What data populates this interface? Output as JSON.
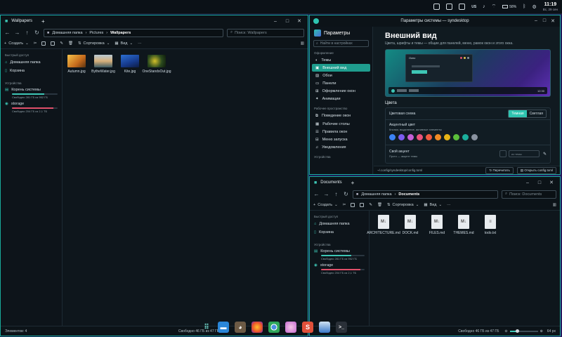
{
  "topbar": {
    "lang": "US",
    "battery": "58%",
    "time": "11:19",
    "date": "Вс, 29 сен"
  },
  "win_wallpapers": {
    "title": "Wallpapers",
    "path": [
      "Домашняя папка",
      "Pictures",
      "Wallpapers"
    ],
    "search_placeholder": "Поиск: Wallpapers",
    "actions": {
      "create": "Создать",
      "sort": "Сортировка",
      "view": "Вид"
    },
    "sidebar": {
      "quick": "Быстрый доступ",
      "home": "Домашняя папка",
      "trash": "Корзина",
      "devices": "Устройства",
      "root": "Корень системы",
      "root_free": "Свободно 281 ГБ из 952 ГБ",
      "storage": "storage",
      "storage_free": "Свободно 204 ГБ из 2,1 ТБ"
    },
    "files": [
      {
        "name": "Autumn.jpg"
      },
      {
        "name": "BytheWater.jpg"
      },
      {
        "name": "Kite.jpg"
      },
      {
        "name": "OneStandsOut.jpg"
      }
    ],
    "status_left": "Элементов: 4",
    "status_right": "Свободно 46 ГБ из 47 ГБ"
  },
  "win_settings": {
    "title": "Параметры системы — syndesktop",
    "header": "Параметры",
    "search": "Найти в настройках",
    "groups": [
      {
        "label": "Оформление",
        "items": [
          "Темы",
          "Внешний вид",
          "Обои",
          "Панели",
          "Оформление окон",
          "Анимации"
        ]
      },
      {
        "label": "Рабочее пространство",
        "items": [
          "Поведение окон",
          "Рабочие столы",
          "Правила окон",
          "Меню запуска",
          "Уведомления"
        ]
      },
      {
        "label": "Устройства",
        "items": []
      }
    ],
    "active_item": "Внешний вид",
    "page_title": "Внешний вид",
    "page_subtitle": "Цвета, шрифты и темы — общие для панелей, меню, рамок окон и этого окна.",
    "preview_window_title": "Окно",
    "preview_time": "12:30",
    "colors_section": "Цвета",
    "scheme_label": "Цветовая схема",
    "scheme_dark": "Темная",
    "scheme_light": "Светлая",
    "accent_label": "Акцентный цвет",
    "accent_desc": "Кнопки, выделение, активные элементы",
    "accent_colors": [
      "#3b82f6",
      "#7c5cf0",
      "#c45fd6",
      "#e9527a",
      "#ee5a3f",
      "#f08a24",
      "#e6b416",
      "#5bbf3a",
      "#1bae9c",
      "#8a93a0"
    ],
    "custom_label": "Свой акцент",
    "custom_desc": "Пусто — акцент темы",
    "custom_placeholder": "из темы",
    "config_path": "~/.config/syndesktop/config.toml",
    "reload": "Перечитать",
    "open_config": "Открыть config.toml"
  },
  "win_documents": {
    "title": "Documents",
    "path": [
      "Домашняя папка",
      "Documents"
    ],
    "search_placeholder": "Поиск: Documents",
    "actions": {
      "create": "Создать",
      "sort": "Сортировка",
      "view": "Вид"
    },
    "sidebar": {
      "quick": "Быстрый доступ",
      "home": "Домашняя папка",
      "trash": "Корзина",
      "devices": "Устройства",
      "root": "Корень системы",
      "root_free": "Свободно 281 ГБ из 952 ГБ",
      "storage": "storage",
      "storage_free": "Свободно 204 ГБ из 2,1 ТБ"
    },
    "files": [
      {
        "name": "ARCHITECTURE.md",
        "badge": "M↓"
      },
      {
        "name": "DOCK.md",
        "badge": "M↓"
      },
      {
        "name": "FILES.md",
        "badge": "M↓"
      },
      {
        "name": "THEMES.md",
        "badge": "M↓"
      },
      {
        "name": "todo.txt",
        "badge": "≡"
      }
    ],
    "status_right": "Свободно 46 ГБ из 47 ГБ",
    "zoom": "64 px"
  },
  "dock": [
    "apps",
    "files",
    "gimp",
    "firefox",
    "chrome",
    "orb",
    "synapse",
    "thunar",
    "terminal"
  ]
}
